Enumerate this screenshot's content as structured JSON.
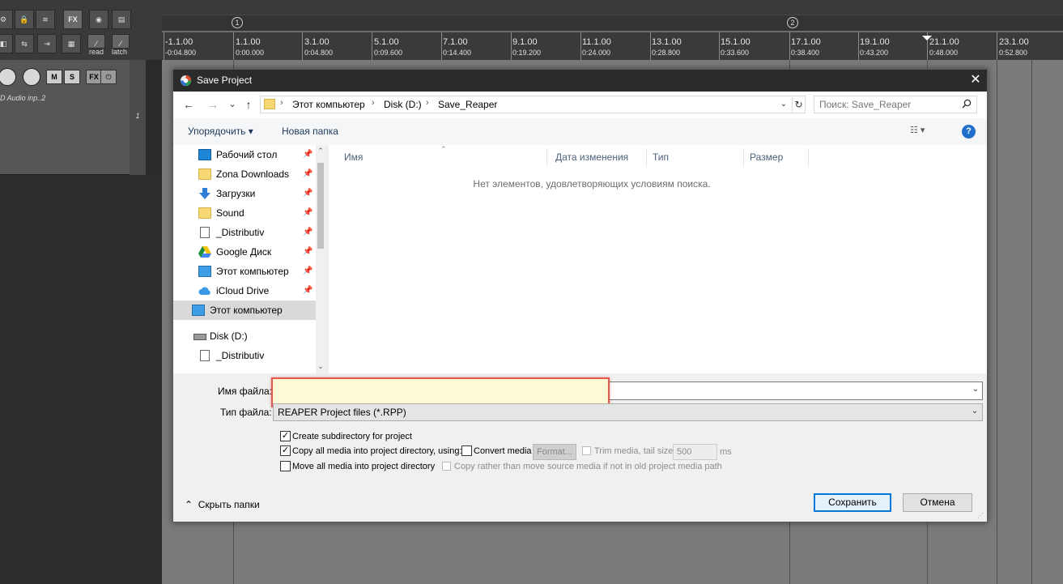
{
  "reaper": {
    "toolbar": {
      "fx_label": "FX",
      "env_read": "read",
      "env_latch": "latch"
    },
    "track": {
      "mute": "M",
      "solo": "S",
      "fx": "FX",
      "input": "D Audio inp..2",
      "number": "1"
    },
    "markers": [
      "1",
      "2"
    ],
    "ruler": [
      {
        "bar": "-1.1.00",
        "time": "-0:04.800"
      },
      {
        "bar": "1.1.00",
        "time": "0:00.000"
      },
      {
        "bar": "3.1.00",
        "time": "0:04.800"
      },
      {
        "bar": "5.1.00",
        "time": "0:09.600"
      },
      {
        "bar": "7.1.00",
        "time": "0:14.400"
      },
      {
        "bar": "9.1.00",
        "time": "0:19.200"
      },
      {
        "bar": "11.1.00",
        "time": "0:24.000"
      },
      {
        "bar": "13.1.00",
        "time": "0:28.800"
      },
      {
        "bar": "15.1.00",
        "time": "0:33.600"
      },
      {
        "bar": "17.1.00",
        "time": "0:38.400"
      },
      {
        "bar": "19.1.00",
        "time": "0:43.200"
      },
      {
        "bar": "21.1.00",
        "time": "0:48.000"
      },
      {
        "bar": "23.1.00",
        "time": "0:52.800"
      }
    ]
  },
  "dialog": {
    "title": "Save Project",
    "close_glyph": "✕",
    "nav": {
      "back": "←",
      "forward": "→",
      "recent": "⌄",
      "up": "↑",
      "breadcrumb": [
        "Этот компьютер",
        "Disk (D:)",
        "Save_Reaper"
      ],
      "sep": "›",
      "search_placeholder": "Поиск: Save_Reaper"
    },
    "commands": {
      "organize": "Упорядочить ▾",
      "new_folder": "Новая папка",
      "view": "☷ ▾",
      "help": "?"
    },
    "sidebar": [
      {
        "label": "Рабочий стол",
        "icon": "desktop-icon",
        "pinned": true
      },
      {
        "label": "Zona Downloads",
        "icon": "folder-icon",
        "pinned": true
      },
      {
        "label": "Загрузки",
        "icon": "download-arrow-icon",
        "pinned": true
      },
      {
        "label": "Sound",
        "icon": "folder-icon",
        "pinned": true
      },
      {
        "label": "_Distributiv",
        "icon": "document-icon",
        "pinned": true
      },
      {
        "label": "Google Диск",
        "icon": "google-drive-icon",
        "pinned": true
      },
      {
        "label": "Этот компьютер",
        "icon": "computer-icon",
        "pinned": true
      },
      {
        "label": "iCloud Drive",
        "icon": "cloud-icon",
        "pinned": true
      },
      {
        "label": "Этот компьютер",
        "icon": "computer-icon",
        "pinned": false,
        "selected": true
      },
      {
        "label": "Disk (D:)",
        "icon": "drive-icon",
        "pinned": false
      },
      {
        "label": "_Distributiv",
        "icon": "document-icon",
        "pinned": false
      }
    ],
    "columns": [
      "Имя",
      "Дата изменения",
      "Тип",
      "Размер"
    ],
    "empty_message": "Нет элементов, удовлетворяющих условиям поиска.",
    "filename_label": "Имя файла:",
    "filename_value": "",
    "filetype_label": "Тип файла:",
    "filetype_value": "REAPER Project files (*.RPP)",
    "options": {
      "create_subdir": {
        "label": "Create subdirectory for project",
        "checked": true
      },
      "copy_media": {
        "label": "Copy all media into project directory, using:",
        "checked": true
      },
      "convert_media": {
        "label": "Convert media",
        "checked": false
      },
      "format_btn": "Format...",
      "trim_media": {
        "label": "Trim media, tail size:",
        "checked": false,
        "disabled": true
      },
      "trim_value": "500",
      "trim_unit": "ms",
      "move_media": {
        "label": "Move all media into project directory",
        "checked": false
      },
      "copy_rather": {
        "label": "Copy rather than move source media if not in old project media path",
        "checked": false,
        "disabled": true
      }
    },
    "hide_folders": "Скрыть папки",
    "save": "Сохранить",
    "cancel": "Отмена"
  }
}
